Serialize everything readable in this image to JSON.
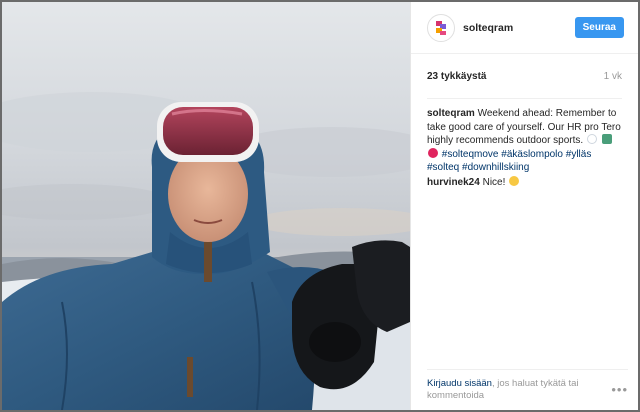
{
  "post": {
    "username": "solteqram",
    "follow_label": "Seuraa",
    "likes": "23 tykkäystä",
    "age": "1 vk",
    "comments": [
      {
        "user": "solteqram",
        "text": "Weekend ahead: Remember to take good care of yourself. Our HR pro Tero highly recommends outdoor sports.",
        "hashtags": [
          "#solteqmove",
          "#äkäslompolo",
          "#ylläs",
          "#solteq",
          "#downhillskiing"
        ]
      },
      {
        "user": "hurvinek24",
        "text": "Nice!"
      }
    ]
  },
  "footer": {
    "login_label": "Kirjaudu sisään",
    "rest_label": ", jos haluat tykätä tai kommentoida",
    "more_label": "•••"
  },
  "icons": {
    "logo": "solteq-logo-icon",
    "heart": "red-heart-emoji",
    "smile": "smiling-face-emoji"
  },
  "colors": {
    "follow_button": "#3897f0",
    "hashtag": "#003569",
    "heart": "#e0245e"
  }
}
